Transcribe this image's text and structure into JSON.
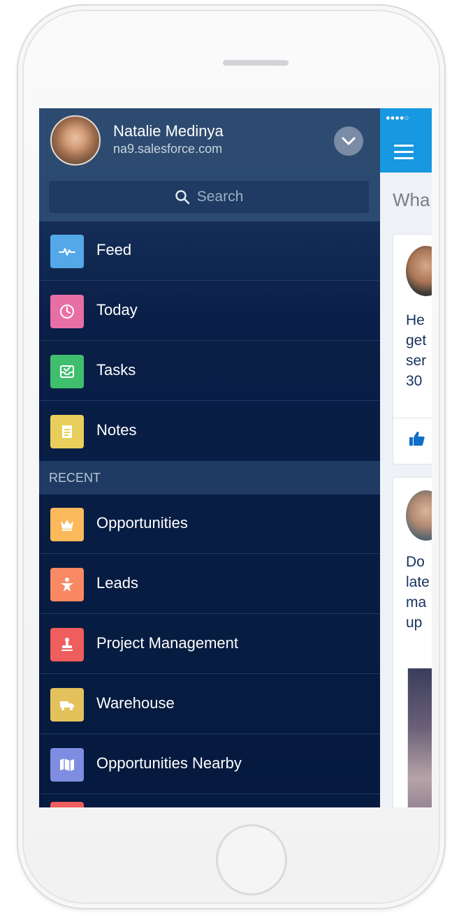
{
  "profile": {
    "name": "Natalie Medinya",
    "host": "na9.salesforce.com"
  },
  "search": {
    "placeholder": "Search"
  },
  "menu": {
    "items": [
      {
        "label": "Feed",
        "icon": "pulse-icon",
        "color": "#54a8e8"
      },
      {
        "label": "Today",
        "icon": "clock-icon",
        "color": "#e76fa6"
      },
      {
        "label": "Tasks",
        "icon": "inbox-check-icon",
        "color": "#3fbf6d"
      },
      {
        "label": "Notes",
        "icon": "note-icon",
        "color": "#e8cf5b"
      }
    ]
  },
  "recent": {
    "header": "RECENT",
    "items": [
      {
        "label": "Opportunities",
        "icon": "crown-icon",
        "color": "#fcb95b"
      },
      {
        "label": "Leads",
        "icon": "person-star-icon",
        "color": "#f88962"
      },
      {
        "label": "Project Management",
        "icon": "stamp-icon",
        "color": "#ef5d5d"
      },
      {
        "label": "Warehouse",
        "icon": "truck-icon",
        "color": "#e3c25c"
      },
      {
        "label": "Opportunities Nearby",
        "icon": "map-icon",
        "color": "#7f8de1"
      }
    ]
  },
  "app": {
    "status_dots": "●●●●○",
    "prompt": "Wha",
    "post1_lines": [
      "He",
      "get",
      "ser",
      "30"
    ],
    "post2_lines": [
      "Do",
      "late",
      "ma",
      "up"
    ]
  },
  "colors": {
    "drawer_bg": "#0a1f47",
    "app_header": "#1798e0"
  }
}
